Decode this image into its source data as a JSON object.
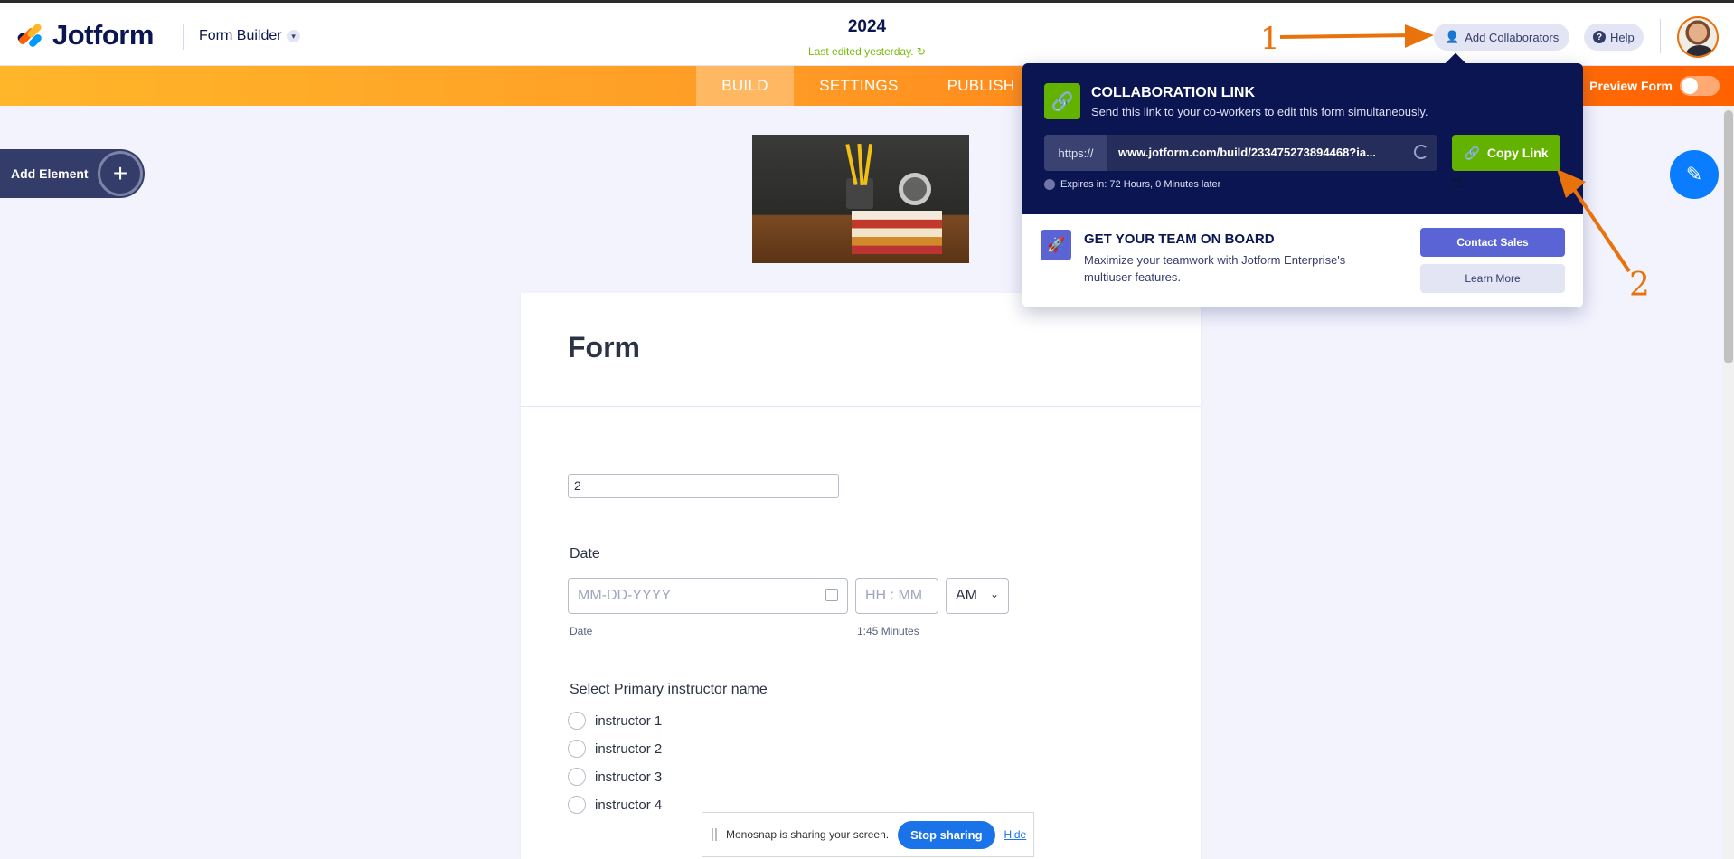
{
  "header": {
    "logo": "Jotform",
    "builder_label": "Form Builder",
    "form_name": "2024",
    "last_edited": "Last edited yesterday.",
    "add_collaborators": "Add Collaborators",
    "help": "Help",
    "avatar": "user-avatar"
  },
  "nav": {
    "tabs": [
      "BUILD",
      "SETTINGS",
      "PUBLISH"
    ],
    "active_tab": "BUILD",
    "preview_label": "Preview Form",
    "preview_on": false
  },
  "left_panel": {
    "add_element": "Add Element"
  },
  "form": {
    "title": "Form",
    "text_input_value": "2",
    "date_label": "Date",
    "date_placeholder": "MM-DD-YYYY",
    "time_placeholder": "HH : MM",
    "ampm_value": "AM",
    "date_sublabel": "Date",
    "time_sublabel": "1:45 Minutes",
    "radio_question": "Select Primary instructor name",
    "radio_options": [
      "instructor 1",
      "instructor 2",
      "instructor 3",
      "instructor 4"
    ]
  },
  "collaboration_popover": {
    "title": "COLLABORATION LINK",
    "description": "Send this link to your co-workers to edit this form simultaneously.",
    "url_protocol": "https://",
    "url": "www.jotform.com/build/233475273894468?ia...",
    "copy_link": "Copy Link",
    "expires": "Expires in: 72 Hours, 0 Minutes later",
    "team_title": "GET YOUR TEAM ON BOARD",
    "team_description": "Maximize your teamwork with Jotform Enterprise's multiuser features.",
    "contact_sales": "Contact Sales",
    "learn_more": "Learn More"
  },
  "annotations": {
    "one": "1",
    "two": "2"
  },
  "sharebar": {
    "message": "Monosnap is sharing your screen.",
    "stop": "Stop sharing",
    "hide": "Hide"
  },
  "colors": {
    "navy": "#0a1551",
    "orange": "#ff6100",
    "green": "#64b200",
    "indigo": "#5b64d4",
    "annotation": "#e8720c"
  }
}
